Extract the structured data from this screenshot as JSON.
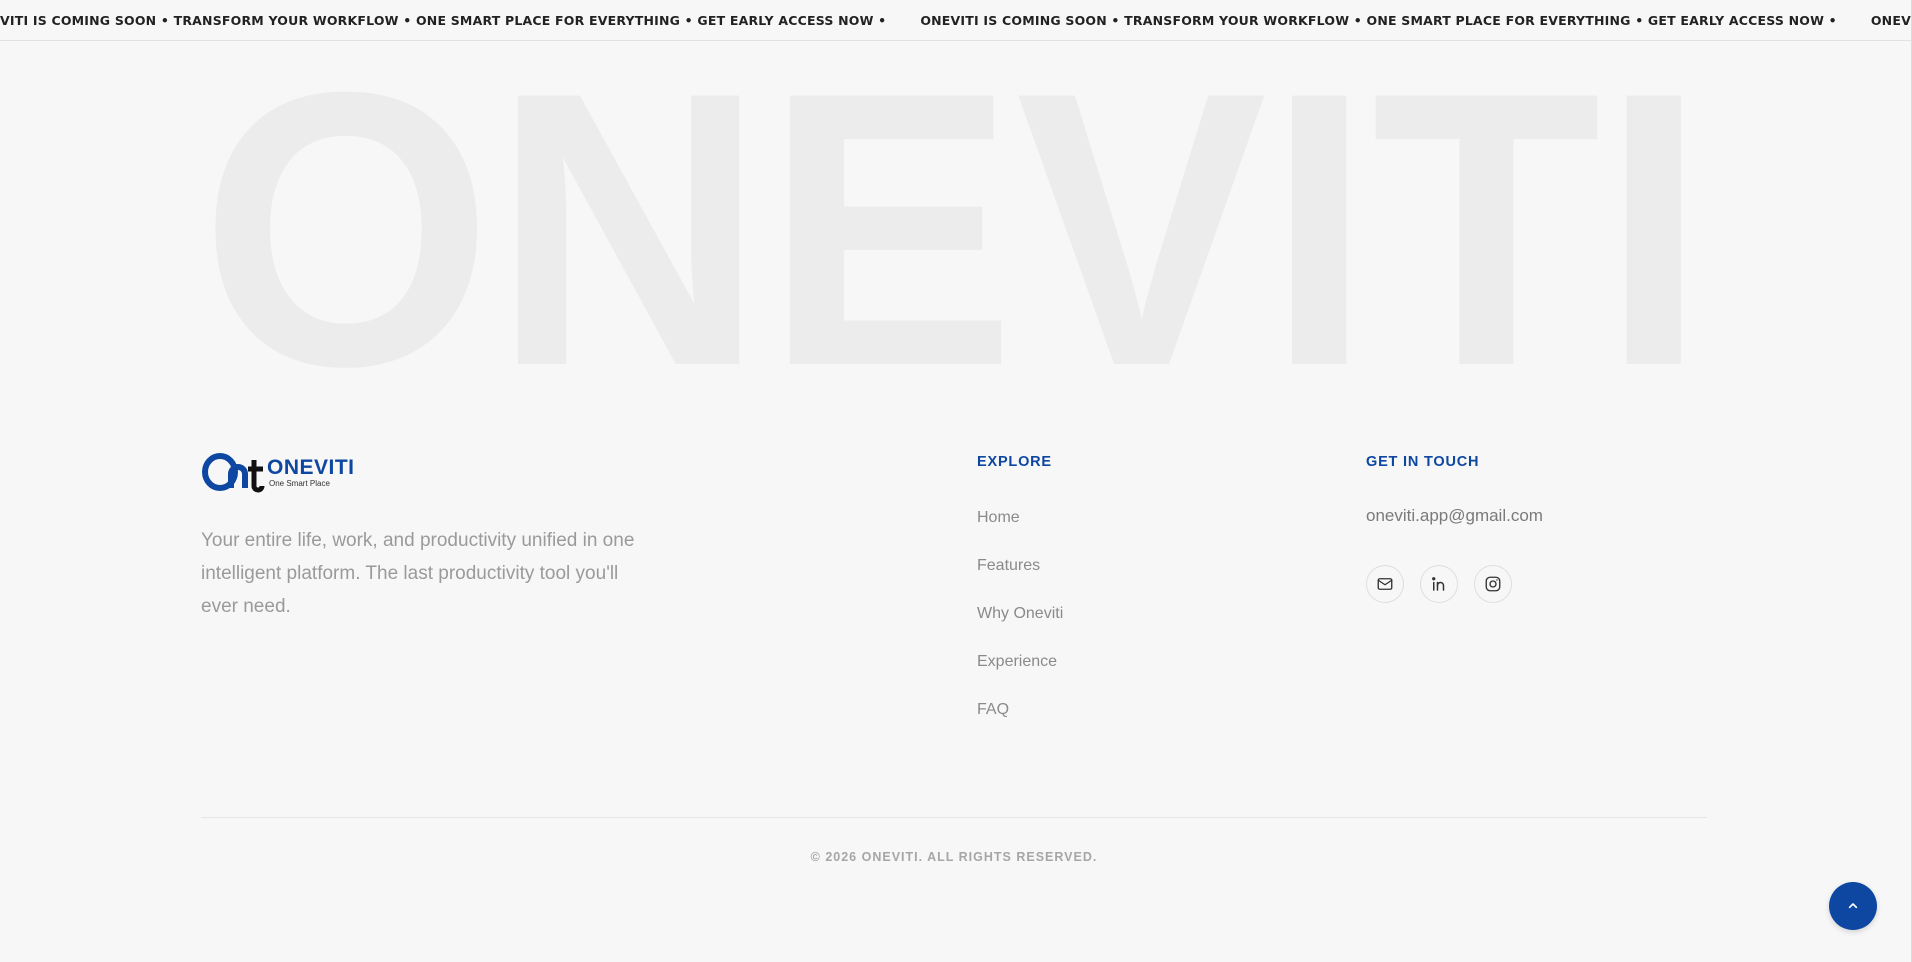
{
  "ticker": {
    "items": [
      "VITI IS COMING SOON • TRANSFORM YOUR WORKFLOW • ONE SMART PLACE FOR EVERYTHING • GET EARLY ACCESS NOW •",
      "ONEVITI IS COMING SOON • TRANSFORM YOUR WORKFLOW • ONE SMART PLACE FOR EVERYTHING • GET EARLY ACCESS NOW •",
      "ONEVITI IS COMING SOON •"
    ]
  },
  "hero": {
    "word": "ONEVITI"
  },
  "brand": {
    "logo_mark": "Onit",
    "name": "ONEVITI",
    "tagline": "One Smart Place"
  },
  "about": {
    "text": "Your entire life, work, and productivity unified in one intelligent platform. The last productivity tool you'll ever need."
  },
  "explore": {
    "title": "EXPLORE",
    "links": [
      "Home",
      "Features",
      "Why Oneviti",
      "Experience",
      "FAQ"
    ]
  },
  "contact": {
    "title": "GET IN TOUCH",
    "email": "oneviti.app@gmail.com",
    "socials": [
      "mail-icon",
      "linkedin-icon",
      "instagram-icon"
    ]
  },
  "footer": {
    "copyright": "© 2026 ONEVITI. ALL RIGHTS RESERVED."
  },
  "colors": {
    "accent": "#0d47a1",
    "background": "#f7f7f7",
    "watermark": "#ececec"
  }
}
